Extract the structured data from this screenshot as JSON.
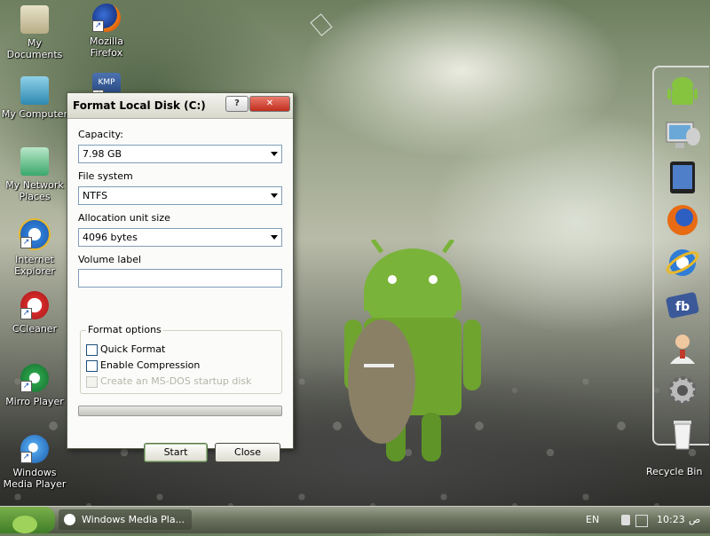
{
  "desktop_icons": [
    {
      "label": "My Documents",
      "icon": "folder-documents-icon"
    },
    {
      "label": "Mozilla Firefox",
      "icon": "firefox-icon"
    },
    {
      "label": "My Computer",
      "icon": "computer-icon"
    },
    {
      "label": "KMP",
      "icon": "kmplayer-icon"
    },
    {
      "label": "My Network Places",
      "icon": "network-icon"
    },
    {
      "label": "Internet Explorer",
      "icon": "ie-icon"
    },
    {
      "label": "CCleaner",
      "icon": "ccleaner-icon"
    },
    {
      "label": "Mirro Player",
      "icon": "mirro-player-icon"
    },
    {
      "label": "Windows Media Player",
      "icon": "media-player-icon"
    }
  ],
  "dialog": {
    "title": "Format Local Disk (C:)",
    "help_btn": "?",
    "close_btn": "✕",
    "capacity_label": "Capacity:",
    "capacity_value": "7.98 GB",
    "filesystem_label": "File system",
    "filesystem_value": "NTFS",
    "alloc_label": "Allocation unit size",
    "alloc_value": "4096 bytes",
    "volume_label": "Volume label",
    "volume_value": "",
    "format_options_legend": "Format options",
    "quick_format": "Quick Format",
    "enable_compression": "Enable Compression",
    "msdos_disk": "Create an MS-DOS startup disk",
    "progress_value": 0,
    "start_button": "Start",
    "close_button": "Close"
  },
  "dock": {
    "items": [
      "android-icon",
      "monitor-icon",
      "ipad-icon",
      "firefox-icon",
      "ie-icon",
      "facebook-icon",
      "support-agent-icon",
      "settings-gear-icon",
      "recycle-bin-icon"
    ],
    "recycle_bin_label": "Recycle Bin"
  },
  "taskbar": {
    "task_label": "Windows Media Pla...",
    "language": "EN",
    "time": "10:23",
    "ampm": "ص"
  },
  "colors": {
    "accent_green": "#3f7d26",
    "dialog_bg": "#ece9d8",
    "close_red": "#c22e1d"
  }
}
